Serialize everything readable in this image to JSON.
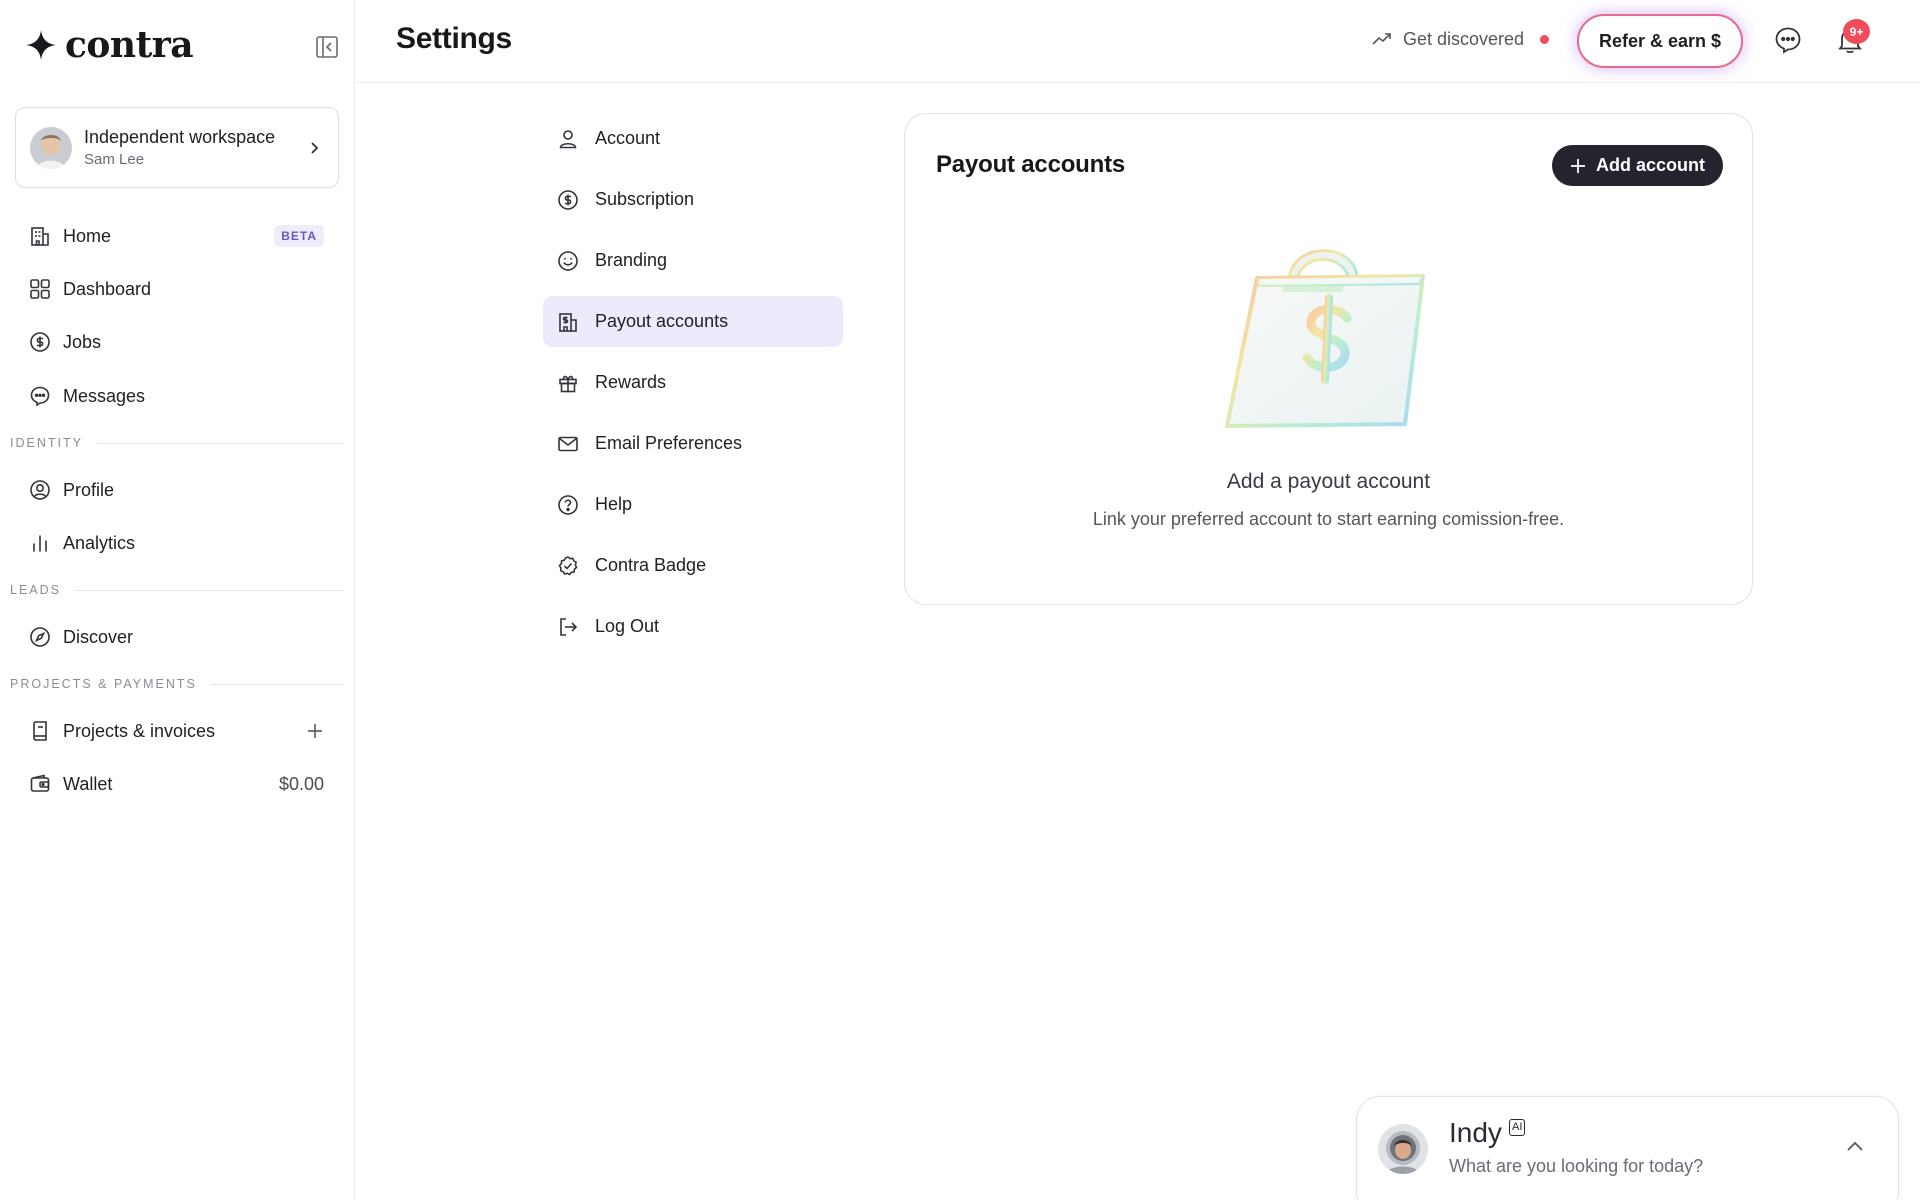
{
  "app": {
    "brand": "contra",
    "page_title": "Settings"
  },
  "workspace": {
    "title": "Independent workspace",
    "user": "Sam Lee"
  },
  "sidebar": {
    "items": [
      {
        "label": "Home",
        "icon": "home-icon",
        "badge": "BETA"
      },
      {
        "label": "Dashboard",
        "icon": "dashboard-icon"
      },
      {
        "label": "Jobs",
        "icon": "dollar-circle-icon"
      },
      {
        "label": "Messages",
        "icon": "messages-icon"
      }
    ],
    "sections": {
      "identity": "IDENTITY",
      "leads": "LEADS",
      "projects_payments": "PROJECTS & PAYMENTS"
    },
    "identity_items": [
      {
        "label": "Profile",
        "icon": "profile-icon"
      },
      {
        "label": "Analytics",
        "icon": "analytics-icon"
      }
    ],
    "leads_items": [
      {
        "label": "Discover",
        "icon": "compass-icon"
      }
    ],
    "payments_items": [
      {
        "label": "Projects & invoices",
        "icon": "invoice-icon"
      },
      {
        "label": "Wallet",
        "icon": "wallet-icon",
        "value": "$0.00"
      }
    ]
  },
  "header": {
    "get_discovered": "Get discovered",
    "refer_label": "Refer & earn $",
    "notification_count": "9+"
  },
  "settings_menu": [
    {
      "label": "Account",
      "icon": "user-icon"
    },
    {
      "label": "Subscription",
      "icon": "dollar-circle-icon"
    },
    {
      "label": "Branding",
      "icon": "smile-icon"
    },
    {
      "label": "Payout accounts",
      "icon": "bank-icon",
      "active": true
    },
    {
      "label": "Rewards",
      "icon": "gift-icon"
    },
    {
      "label": "Email Preferences",
      "icon": "mail-icon"
    },
    {
      "label": "Help",
      "icon": "help-icon"
    },
    {
      "label": "Contra Badge",
      "icon": "badge-icon"
    },
    {
      "label": "Log Out",
      "icon": "logout-icon"
    }
  ],
  "card": {
    "title": "Payout accounts",
    "add_label": "Add account",
    "empty_title": "Add a payout account",
    "empty_subtitle": "Link your preferred account to start earning comission-free."
  },
  "indy": {
    "name": "Indy",
    "ai_label": "AI",
    "prompt": "What are you looking for today?"
  },
  "colors": {
    "accent_active_bg": "#ecebfb",
    "primary_button": "#23242d",
    "notification_red": "#ef4d5b"
  }
}
